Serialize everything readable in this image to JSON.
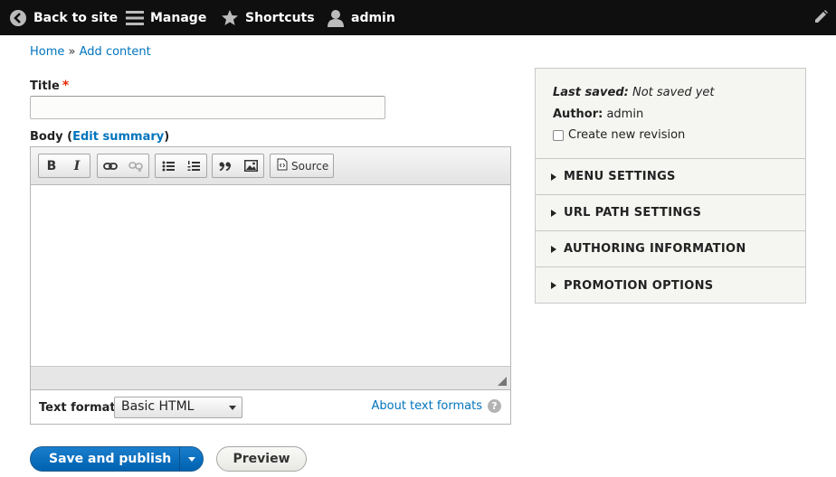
{
  "toolbar": {
    "back_label": "Back to site",
    "manage_label": "Manage",
    "shortcuts_label": "Shortcuts",
    "user_label": "admin",
    "back_icon": "back-arrow-icon",
    "manage_icon": "hamburger-icon",
    "shortcuts_icon": "star-icon",
    "user_icon": "person-icon",
    "edit_icon": "pencil-icon"
  },
  "breadcrumb": {
    "home": "Home",
    "separator": "»",
    "current": "Add content"
  },
  "form": {
    "title_label": "Title",
    "title_required_mark": "*",
    "title_value": "",
    "body_label": "Body",
    "body_open_paren": "(",
    "edit_summary_link": "Edit summary",
    "body_close_paren": ")",
    "editor_buttons": {
      "bold": "B",
      "italic": "I",
      "source": "Source"
    },
    "text_format_label": "Text format",
    "text_format_selected": "Basic HTML",
    "about_text_formats": "About text formats",
    "help_glyph": "?"
  },
  "actions": {
    "save_publish": "Save and publish",
    "preview": "Preview"
  },
  "sidebar": {
    "last_saved_label": "Last saved:",
    "last_saved_value": "Not saved yet",
    "author_label": "Author:",
    "author_value": "admin",
    "new_revision_label": "Create new revision",
    "new_revision_checked": false,
    "sections": [
      {
        "label": "MENU SETTINGS"
      },
      {
        "label": "URL PATH SETTINGS"
      },
      {
        "label": "AUTHORING INFORMATION"
      },
      {
        "label": "PROMOTION OPTIONS"
      }
    ]
  },
  "colors": {
    "toolbar_bg": "#0f0f0f",
    "link": "#0074bd",
    "primary_button": "#0071c5",
    "required": "#e62600"
  }
}
